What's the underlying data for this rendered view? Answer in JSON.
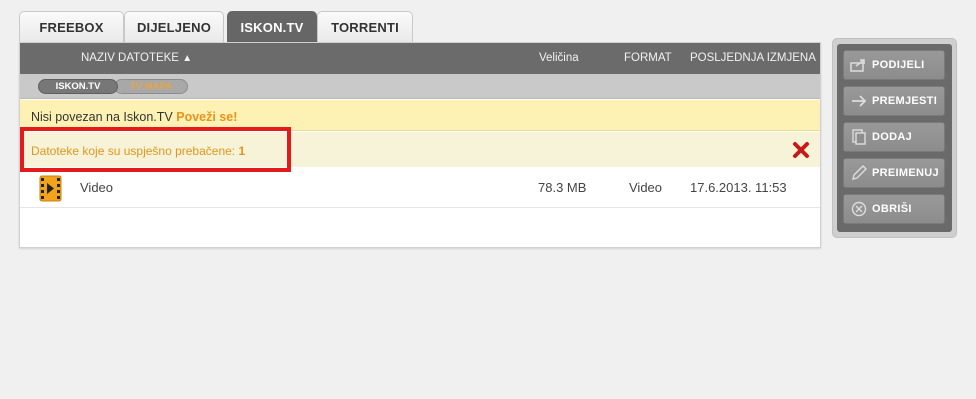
{
  "tabs": [
    {
      "label": "FREEBOX",
      "active": false
    },
    {
      "label": "DIJELJENO",
      "active": false
    },
    {
      "label": "ISKON.TV",
      "active": true
    },
    {
      "label": "TORRENTI",
      "active": false
    }
  ],
  "table": {
    "columns": {
      "name": "NAZIV DATOTEKE",
      "sort_indicator": "▲",
      "size": "Veličina",
      "format": "FORMAT",
      "modified": "POSLJEDNJA IZMJENA"
    },
    "breadcrumb": [
      "ISKON.TV",
      "TV MAPA"
    ],
    "notice": {
      "text": "Nisi povezan na Iskon.TV",
      "link": "Poveži se!"
    },
    "success": {
      "text": "Datoteke koje su uspješno prebačene:",
      "count": "1"
    },
    "rows": [
      {
        "name": "Video",
        "size": "78.3 MB",
        "format": "Video",
        "modified": "17.6.2013. 11:53",
        "icon": "video-file-icon"
      }
    ]
  },
  "sidebar": {
    "buttons": [
      {
        "label": "PODIJELI",
        "icon": "share-icon"
      },
      {
        "label": "PREMJESTI",
        "icon": "arrow-right-icon"
      },
      {
        "label": "DODAJ",
        "icon": "add-document-icon"
      },
      {
        "label": "PREIMENUJ",
        "icon": "pencil-icon"
      },
      {
        "label": "OBRIŠI",
        "icon": "delete-circle-icon"
      }
    ]
  },
  "colors": {
    "accent_orange": "#e8931e",
    "header_gray": "#6b6b6b",
    "highlight_red": "#e31b1b",
    "close_red": "#c61a1a"
  }
}
